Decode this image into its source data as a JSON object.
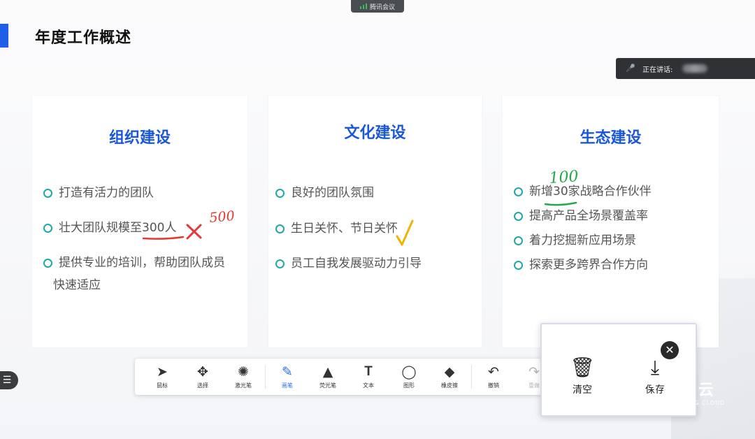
{
  "meeting": {
    "app_name": "腾讯会议"
  },
  "slide": {
    "title": "年度工作概述",
    "cards": [
      {
        "title": "组织建设",
        "bullets": [
          "打造有活力的团队",
          "壮大团队规模至300人",
          "提供专业的培训，帮助团队成员",
          "快速适应"
        ]
      },
      {
        "title": "文化建设",
        "bullets": [
          "良好的团队氛围",
          "生日关怀、节日关怀",
          "员工自我发展驱动力引导"
        ]
      },
      {
        "title": "生态建设",
        "bullets": [
          "新增30家战略合作伙伴",
          "提高产品全场景覆盖率",
          "着力挖掘新应用场景",
          "探索更多跨界合作方向"
        ]
      }
    ]
  },
  "speaker": {
    "label": "正在讲话:"
  },
  "annotations": {
    "note_1": "500",
    "note_2": "100"
  },
  "toolbar": {
    "tools": [
      {
        "label": "鼠标",
        "icon": "cursor-icon"
      },
      {
        "label": "选择",
        "icon": "move-icon"
      },
      {
        "label": "激光笔",
        "icon": "laser-icon"
      },
      {
        "label": "画笔",
        "icon": "pen-icon",
        "active": true
      },
      {
        "label": "荧光笔",
        "icon": "highlighter-icon"
      },
      {
        "label": "文本",
        "icon": "text-icon"
      },
      {
        "label": "图形",
        "icon": "circle-icon"
      },
      {
        "label": "橡皮擦",
        "icon": "eraser-icon"
      },
      {
        "label": "撤销",
        "icon": "undo-icon"
      },
      {
        "label": "重做",
        "icon": "redo-icon",
        "disabled": true
      }
    ]
  },
  "popup": {
    "clear_label": "清空",
    "save_label": "保存"
  },
  "watermark": {
    "main": "小象云",
    "sub": "XIAOXIANG CLOUD"
  },
  "colors": {
    "accent": "#1f5ee6",
    "title_blue": "#1a58d8",
    "bullet_ring": "#1ea8a5",
    "ink_red": "#e53935",
    "ink_yellow": "#f0b400",
    "ink_green": "#23a84a"
  }
}
